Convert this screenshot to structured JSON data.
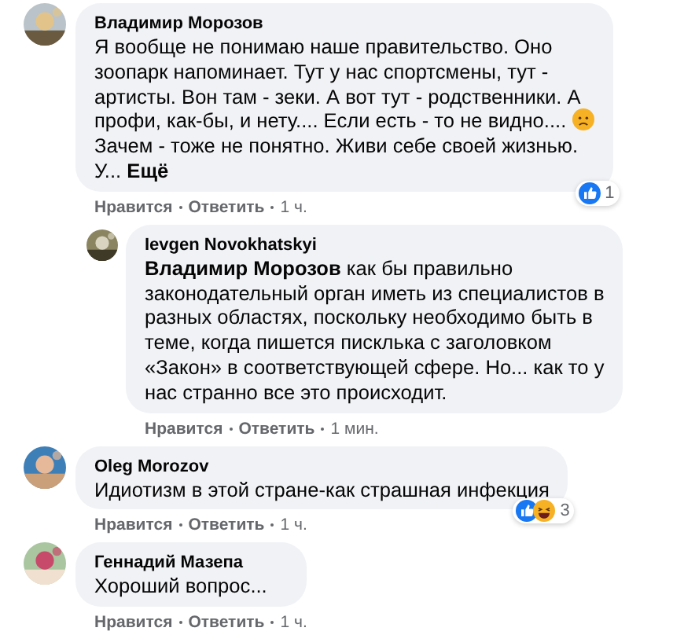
{
  "comments": [
    {
      "author": "Владимир Морозов",
      "reply": false,
      "text": "Я вообще не понимаю наше правительство. Оно\nзоопарк напоминает. Тут у нас спортсмены, тут -\nартисты. Вон там - зеки. А вот тут - родственники. А\nпрофи, как-бы, и нету.... Если есть - то не видно....",
      "emoji": {
        "kind": "sad"
      },
      "text_after": "\nЗачем - тоже не понятно. Живи себе своей жизнью.\nУ...",
      "see_more": "Ещё",
      "reactions": {
        "kinds": [
          {
            "kind": "like"
          }
        ],
        "count": "1"
      },
      "actions": [
        "Нравится",
        "Ответить"
      ],
      "time": "1 ч."
    },
    {
      "author": "Ievgen Novokhatskyi",
      "reply": true,
      "mention": "Владимир Морозов",
      "text": "как бы правильно\nзаконодательный орган иметь из специалистов в\nразных областях, поскольку необходимо быть в\nтеме, когда пишется писклька с заголовком\n«Закон» в соответствующей сфере. Но... как то у\nнас странно все это происходит.",
      "actions": [
        "Нравится",
        "Ответить"
      ],
      "time": "1 мин."
    },
    {
      "author": "Oleg Morozov",
      "reply": false,
      "text": "Идиотизм в этой стране-как страшная инфекция",
      "reactions": {
        "kinds": [
          {
            "kind": "like"
          },
          {
            "kind": "haha"
          }
        ],
        "count": "3"
      },
      "actions": [
        "Нравится",
        "Ответить"
      ],
      "time": "1 ч."
    },
    {
      "author": "Геннадий Мазепа",
      "reply": false,
      "text": "Хороший вопрос...",
      "actions": [
        "Нравится",
        "Ответить"
      ],
      "time": "1 ч."
    }
  ]
}
